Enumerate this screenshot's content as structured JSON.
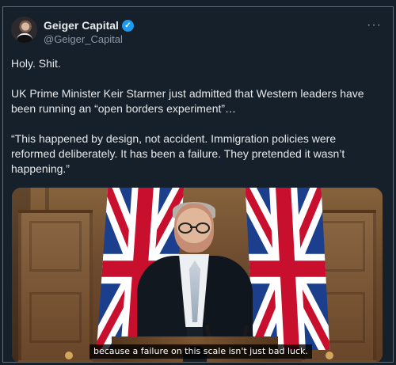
{
  "post": {
    "author": {
      "display_name": "Geiger Capital",
      "handle": "@Geiger_Capital",
      "verified_icon": "verified-badge-icon"
    },
    "more_label": "···",
    "text": {
      "line1": "Holy. Shit.",
      "paragraph2": "UK Prime Minister Keir Starmer just admitted that Western leaders have been running an “open borders experiment”…",
      "paragraph3": "“This happened by design, not accident. Immigration policies were reformed deliberately. It has been a failure. They pretended it wasn’t happening.”"
    },
    "media": {
      "caption": "because a failure on this scale isn't just bad luck."
    }
  },
  "colors": {
    "background": "#15202b",
    "text": "#e7e9ea",
    "muted": "#8b98a5",
    "verified": "#1d9bf0"
  }
}
